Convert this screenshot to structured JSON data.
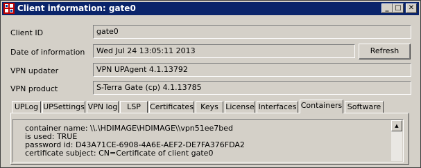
{
  "window": {
    "title": "Client information: gate0",
    "controls": {
      "minimize": "_",
      "maximize": "□",
      "close": "✕"
    }
  },
  "fields": {
    "client_id": {
      "label": "Client ID",
      "value": "gate0"
    },
    "date": {
      "label": "Date of information",
      "value": "Wed Jul 24 13:05:11 2013"
    },
    "vpn_updater": {
      "label": "VPN updater",
      "value": "VPN UPAgent 4.1.13792"
    },
    "vpn_product": {
      "label": "VPN product",
      "value": "S-Terra Gate (cp) 4.1.13785"
    }
  },
  "refresh_label": "Refresh",
  "tabs": [
    "UPLog",
    "UPSettings",
    "VPN log",
    "LSP",
    "Certificates",
    "Keys",
    "License",
    "Interfaces",
    "Containers",
    "Software"
  ],
  "active_tab": "Containers",
  "content_lines": [
    "container name: \\\\.\\HDIMAGE\\HDIMAGE\\\\vpn51ee7bed",
    "is used: TRUE",
    "password id: D43A71CE-6908-4A6E-AEF2-DE7FA376FDA2",
    "certificate subject: CN=Certificate of client gate0"
  ]
}
